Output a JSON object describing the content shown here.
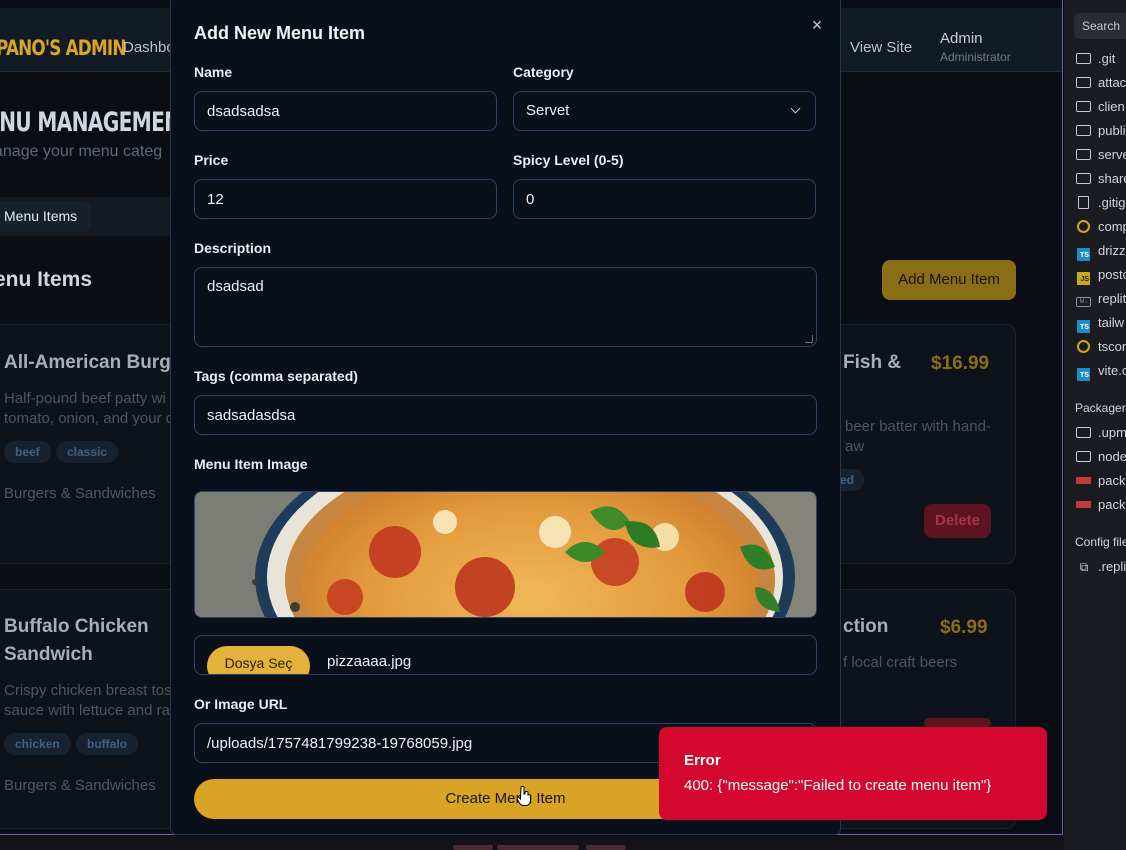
{
  "app": {
    "brand": "PANO'S ADMIN",
    "nav": {
      "dashboard": "Dashbo",
      "view_site": "View Site",
      "admin_name": "Admin",
      "admin_role": "Administrator"
    },
    "page_title": "ENU MANAGEMENT",
    "page_subtitle": "anage your menu categ",
    "tab_menu_items": "Menu Items",
    "section_title": "enu Items",
    "add_button": "Add Menu Item",
    "cards": [
      {
        "name": "All-American Burge",
        "desc_line1": "Half-pound beef patty wi",
        "desc_line2": "tomato, onion, and your c",
        "tags": [
          "beef",
          "classic"
        ],
        "category": "Burgers & Sandwiches"
      },
      {
        "name": "Fish &",
        "price": "$16.99",
        "desc_line1": "beer batter with hand-",
        "desc_line2": "aw",
        "tag_partial": "ed",
        "delete_label": "Delete"
      },
      {
        "name_line1": "Buffalo Chicken",
        "name_line2": "Sandwich",
        "desc_line1": "Crispy chicken breast tos",
        "desc_line2": "sauce with lettuce and ra",
        "tags": [
          "chicken",
          "buffalo"
        ],
        "category": "Burgers & Sandwiches"
      },
      {
        "name": "ction",
        "price": "$6.99",
        "desc_line1": "f local craft beers"
      }
    ]
  },
  "modal": {
    "title": "Add New Menu Item",
    "close_glyph": "×",
    "name_label": "Name",
    "name_value": "dsadsadsa",
    "category_label": "Category",
    "category_value": "Servet",
    "price_label": "Price",
    "price_value": "12",
    "spicy_label": "Spicy Level (0-5)",
    "spicy_value": "0",
    "description_label": "Description",
    "description_value": "dsadsad",
    "tags_label": "Tags (comma separated)",
    "tags_value": "sadsadasdsa",
    "image_label": "Menu Item Image",
    "file_button": "Dosya Seç",
    "file_name": "pizzaaaa.jpg",
    "image_url_label": "Or Image URL",
    "image_url_value": "/uploads/1757481799238-19768059.jpg",
    "submit_label": "Create Menu Item"
  },
  "toast": {
    "title": "Error",
    "message": "400: {\"message\":\"Failed to create menu item\"}"
  },
  "explorer": {
    "search_label": "Search",
    "files": [
      {
        "name": ".git",
        "icon": "folder-icon"
      },
      {
        "name": "attac",
        "icon": "folder-icon"
      },
      {
        "name": "clien",
        "icon": "folder-icon"
      },
      {
        "name": "publi",
        "icon": "folder-icon"
      },
      {
        "name": "serve",
        "icon": "folder-icon"
      },
      {
        "name": "share",
        "icon": "folder-icon"
      },
      {
        "name": ".gitig",
        "icon": "file-icon"
      },
      {
        "name": "comp",
        "icon": "config-icon"
      },
      {
        "name": "drizz",
        "icon": "typescript-icon"
      },
      {
        "name": "postc",
        "icon": "javascript-icon"
      },
      {
        "name": "replit",
        "icon": "markdown-icon"
      },
      {
        "name": "tailw",
        "icon": "typescript-icon"
      },
      {
        "name": "tscor",
        "icon": "config-icon"
      },
      {
        "name": "vite.c",
        "icon": "typescript-icon"
      }
    ],
    "packager_heading": "Packager",
    "packager_files": [
      {
        "name": ".upm",
        "icon": "folder-icon"
      },
      {
        "name": "node",
        "icon": "folder-icon"
      },
      {
        "name": "pack",
        "icon": "npm-icon"
      },
      {
        "name": "pack",
        "icon": "npm-icon"
      }
    ],
    "config_heading": "Config file",
    "config_files": [
      {
        "name": ".repli",
        "icon": "replit-config-icon"
      }
    ]
  },
  "colors": {
    "accent_gold": "#d9a325",
    "error_red": "#d4072f",
    "modal_bg": "#0a0f1c",
    "field_border": "#2c4366"
  }
}
